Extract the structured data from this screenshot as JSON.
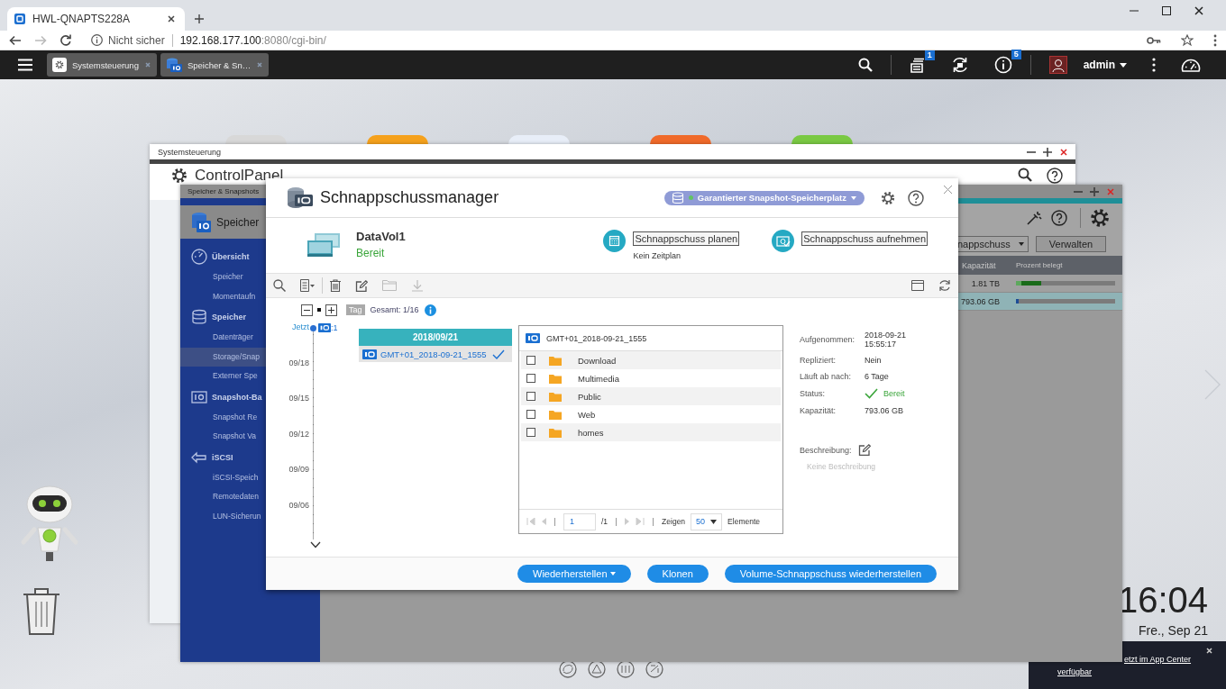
{
  "browser": {
    "tab_title": "HWL-QNAPTS228A",
    "security_label": "Nicht sicher",
    "url_host": "192.168.177.100",
    "url_path": ":8080/cgi-bin/"
  },
  "taskbar": {
    "apps": [
      {
        "label": "Systemsteuerung",
        "kind": "settings"
      },
      {
        "label": "Speicher & Sn…",
        "kind": "storage"
      }
    ],
    "task_badge": "1",
    "notice_badge": "5",
    "user": "admin"
  },
  "desktop": {
    "clock": "16:04",
    "date": "Fre., Sep 21",
    "notification": {
      "line_1": "etzt im App Center",
      "line_2": "verfügbar"
    }
  },
  "control_panel": {
    "title": "Systemsteuerung",
    "heading": "ControlPanel"
  },
  "storage_window": {
    "title": "Speicher & Snapshots",
    "header": "Speicher",
    "sidebar": [
      {
        "label": "Übersicht",
        "kind": "section",
        "selected": false
      },
      {
        "label": "Speicher",
        "kind": "item",
        "selected": false
      },
      {
        "label": "Momentaufn",
        "kind": "item",
        "selected": false
      },
      {
        "label": "Speicher",
        "kind": "section",
        "selected": false
      },
      {
        "label": "Datenträger",
        "kind": "item",
        "selected": false
      },
      {
        "label": "Storage/Snap",
        "kind": "item",
        "selected": true
      },
      {
        "label": "Externer Spe",
        "kind": "item",
        "selected": false
      },
      {
        "label": "Snapshot-Ba",
        "kind": "section",
        "selected": false
      },
      {
        "label": "Snapshot Re",
        "kind": "item",
        "selected": false
      },
      {
        "label": "Snapshot Va",
        "kind": "item",
        "selected": false
      },
      {
        "label": "iSCSI",
        "kind": "section",
        "selected": false
      },
      {
        "label": "iSCSI-Speich",
        "kind": "item",
        "selected": false
      },
      {
        "label": "Remotedaten",
        "kind": "item",
        "selected": false
      },
      {
        "label": "LUN-Sicherun",
        "kind": "item",
        "selected": false
      }
    ],
    "dropdown": "nappschuss",
    "manage_button": "Verwalten",
    "columns": [
      "Kapazität",
      "Prozent belegt"
    ],
    "rows": [
      {
        "capacity": "1.81 TB",
        "level": 0.25,
        "selected": false
      },
      {
        "capacity": "793.06 GB",
        "level": 0.03,
        "selected": true
      }
    ]
  },
  "modal": {
    "title": "Schnappschussmanager",
    "space_button": "Garantierter Snapshot-Speicherplatz",
    "volume": {
      "name": "DataVol1",
      "status": "Bereit"
    },
    "actions": [
      {
        "label": "Schnappschuss planen",
        "note": "Kein Zeitplan",
        "kind": "schedule"
      },
      {
        "label": "Schnappschuss aufnehmen",
        "kind": "capture"
      }
    ],
    "tools": [
      {
        "kind": "search",
        "disabled": false
      },
      {
        "kind": "list",
        "disabled": false
      },
      {
        "kind": "delete",
        "disabled": false
      },
      {
        "kind": "edit",
        "disabled": false
      },
      {
        "kind": "folder",
        "disabled": true
      },
      {
        "kind": "download",
        "disabled": true
      }
    ],
    "timeline": {
      "scale": "Tag",
      "total": "Gesamt: 1/16",
      "now": "Jetzt",
      "count": ":1",
      "dates": [
        "09/18",
        "09/15",
        "09/12",
        "09/09",
        "09/06"
      ]
    },
    "date_group": {
      "date": "2018/09/21",
      "snapshots": [
        {
          "name": "GMT+01_2018-09-21_1555",
          "selected": true
        }
      ]
    },
    "files": {
      "title": "GMT+01_2018-09-21_1555",
      "rows": [
        {
          "name": "Download",
          "checked": false
        },
        {
          "name": "Multimedia",
          "checked": false
        },
        {
          "name": "Public",
          "checked": false
        },
        {
          "name": "Web",
          "checked": false
        },
        {
          "name": "homes",
          "checked": false
        }
      ],
      "pager": {
        "page": "1",
        "pages": "/1",
        "show": "Zeigen",
        "per_page": "50",
        "unit": "Elemente"
      }
    },
    "details": [
      {
        "label": "Aufgenommen:",
        "lines": [
          "2018-09-21",
          "15:55:17"
        ],
        "kind": "text"
      },
      {
        "label": "Repliziert:",
        "lines": [
          "Nein"
        ],
        "kind": "text"
      },
      {
        "label": "Läuft ab nach:",
        "lines": [
          "6 Tage"
        ],
        "kind": "text"
      },
      {
        "label": "Status:",
        "lines": [
          "Bereit"
        ],
        "kind": "status"
      },
      {
        "label": "Kapazität:",
        "lines": [
          "793.06 GB"
        ],
        "kind": "text"
      }
    ],
    "description": {
      "label": "Beschreibung:",
      "empty_text": "Keine Beschreibung"
    },
    "buttons": [
      {
        "label": "Wiederherstellen",
        "dropdown": true
      },
      {
        "label": "Klonen",
        "dropdown": false
      },
      {
        "label": "Volume-Schnappschuss wiederherstellen",
        "dropdown": false
      }
    ]
  }
}
